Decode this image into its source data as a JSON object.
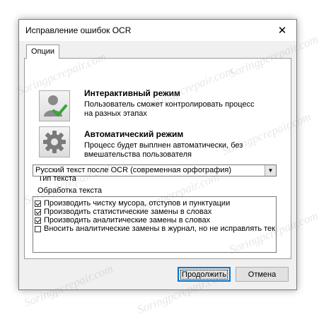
{
  "window": {
    "title": "Исправление ошибок OCR"
  },
  "tabs": [
    {
      "label": "Опции"
    }
  ],
  "modes": [
    {
      "title": "Интерактивный режим",
      "desc_line1": "Пользователь сможет контролировать процесс",
      "desc_line2": "на разных этапах",
      "icon": "user-check-icon"
    },
    {
      "title": "Автоматический режим",
      "desc_line1": "Процесс будет выплнен автоматически, без",
      "desc_line2": "вмешательства пользователя",
      "icon": "gear-icon"
    }
  ],
  "text_type": {
    "label": "Тип текста",
    "selected": "Русский текст после OCR (современная орфография)"
  },
  "processing": {
    "label": "Обработка текста",
    "items": [
      {
        "label": "Производить чистку мусора, отступов и пунктуации",
        "checked": true
      },
      {
        "label": "Производить статистические замены в словах",
        "checked": true
      },
      {
        "label": "Производить аналитические замены в словах",
        "checked": true
      },
      {
        "label": "Вносить аналитические замены в журнал, но не исправлять тек",
        "checked": false
      }
    ]
  },
  "buttons": {
    "continue": "Продолжить",
    "cancel": "Отмена"
  },
  "watermark": "Soringpcrepair.com",
  "colors": {
    "accent": "#0078d7",
    "check_green": "#3aa33a"
  }
}
